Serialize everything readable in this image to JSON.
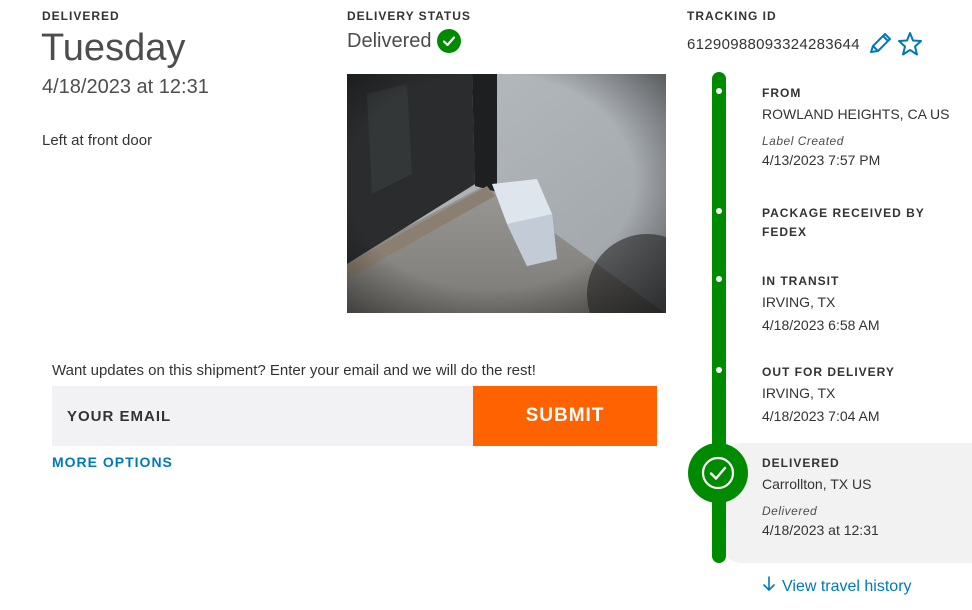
{
  "delivered": {
    "label": "DELIVERED",
    "day": "Tuesday",
    "datetime": "4/18/2023 at 12:31",
    "note": "Left at front door"
  },
  "status": {
    "label": "DELIVERY STATUS",
    "value": "Delivered",
    "icon": "check-circle-icon"
  },
  "tracking": {
    "label": "TRACKING ID",
    "id": "61290988093324283644",
    "icons": [
      "edit-pencil-icon",
      "star-icon"
    ]
  },
  "email_form": {
    "prompt": "Want updates on this shipment? Enter your email and we will do the rest!",
    "placeholder": "YOUR EMAIL",
    "submit": "SUBMIT",
    "more_options": "MORE OPTIONS"
  },
  "timeline": {
    "steps": [
      {
        "title": "FROM",
        "location": "ROWLAND HEIGHTS, CA US",
        "sub": "Label Created",
        "time": "4/13/2023 7:57 PM"
      },
      {
        "title": "PACKAGE RECEIVED BY FEDEX"
      },
      {
        "title": "IN TRANSIT",
        "location": "IRVING, TX",
        "time": "4/18/2023 6:58 AM"
      },
      {
        "title": "OUT FOR DELIVERY",
        "location": "IRVING, TX",
        "time": "4/18/2023 7:04 AM"
      },
      {
        "title": "DELIVERED",
        "location": "Carrollton, TX US",
        "sub": "Delivered",
        "time": "4/18/2023 at 12:31"
      }
    ],
    "history_link": "View travel history"
  },
  "colors": {
    "accent_green": "#008a00",
    "submit_orange": "#ff6200",
    "link_blue": "#007ab7"
  }
}
